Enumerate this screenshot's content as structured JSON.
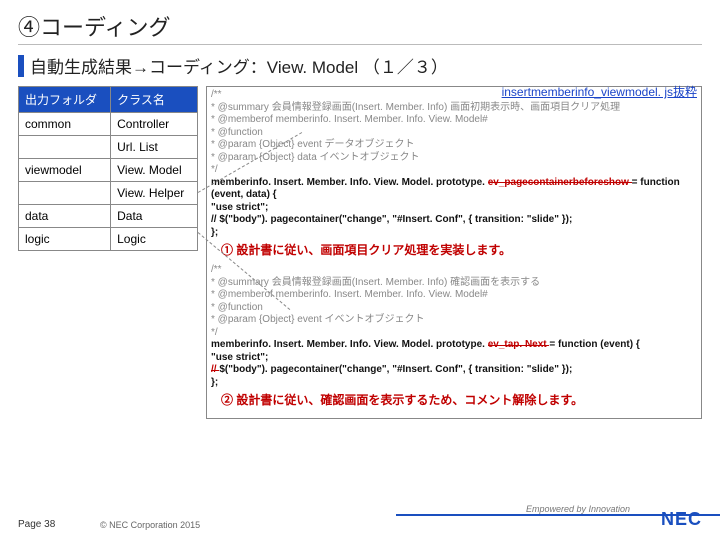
{
  "title": "④コーディング",
  "subtitle": "自動生成結果→コーディング：View. Model （１／３）",
  "table": {
    "headers": [
      "出力フォルダ",
      "クラス名"
    ],
    "rows": [
      [
        "common",
        "Controller"
      ],
      [
        "",
        "Url. List"
      ],
      [
        "viewmodel",
        "View. Model"
      ],
      [
        "",
        "View. Helper"
      ],
      [
        "data",
        "Data"
      ],
      [
        "logic",
        "Logic"
      ]
    ]
  },
  "code": {
    "header": "insertmemberinfo_viewmodel. js抜粋",
    "block1": {
      "l1": "/**",
      "l2": " * @summary 会員情報登録画面(Insert. Member. Info) 画面初期表示時、画面項目クリア処理",
      "l3": " * @memberof memberinfo. Insert. Member. Info. View. Model#",
      "l4": " * @function",
      "l5": " * @param {Object} event データオブジェクト",
      "l6": " * @param {Object} data イベントオブジェクト",
      "l7": " */",
      "sig1a": "memberinfo. Insert. Member. Info. View. Model. prototype. ",
      "sig1b": "ev_pagecontainerbeforeshow ",
      "sig1c": "= function (event, data) {",
      "body1": "    \"use strict\";",
      "body2": "    // $(\"body\"). pagecontainer(\"change\", \"#Insert. Conf\", { transition: \"slide\" });",
      "body3": "};"
    },
    "note1": "① 設計書に従い、画面項目クリア処理を実装します。",
    "block2": {
      "l1": "/**",
      "l2": " * @summary 会員情報登録画面(Insert. Member. Info) 確認画面を表示する",
      "l3": " * @memberof memberinfo. Insert. Member. Info. View. Model#",
      "l4": " * @function",
      "l5": " * @param {Object} event イベントオブジェクト",
      "l6": " */",
      "sig2a": "memberinfo. Insert. Member. Info. View. Model. prototype. ",
      "sig2b": "ev_tap. Next ",
      "sig2c": "= function (event) {",
      "body1": "    \"use strict\";",
      "body2a": "    // ",
      "body2b": "$(\"body\"). pagecontainer(\"change\", \"#Insert. Conf\", { transition: \"slide\" });",
      "body3": "};"
    },
    "note2": "② 設計書に従い、確認画面を表示するため、コメント解除します。"
  },
  "footer": {
    "page": "Page 38",
    "copy": "© NEC Corporation 2015",
    "tagline": "Empowered by Innovation",
    "logo": "NEC"
  }
}
